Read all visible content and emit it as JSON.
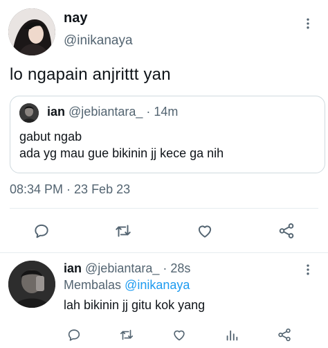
{
  "main_tweet": {
    "display_name": "nay",
    "handle": "@inikanaya",
    "text": "lo ngapain anjrittt yan",
    "timestamp": "08:34 PM · 23 Feb 23"
  },
  "quoted_tweet": {
    "display_name": "ian",
    "handle": "@jebiantara_",
    "separator": " · ",
    "time": "14m",
    "line1": "gabut ngab",
    "line2": "ada yg mau gue bikinin jj kece ga nih"
  },
  "reply": {
    "display_name": "ian",
    "handle": "@jebiantara_",
    "separator": " · ",
    "time": "28s",
    "replying_label": "Membalas",
    "replying_to": "@inikanaya",
    "text": "lah bikinin jj gitu kok yang"
  },
  "icons": [
    "more-icon",
    "reply-icon",
    "retweet-icon",
    "like-icon",
    "share-icon",
    "stats-icon"
  ],
  "colors": {
    "text": "#0f1419",
    "muted": "#536471",
    "link": "#1d9bf0",
    "border": "#cfd9de"
  }
}
